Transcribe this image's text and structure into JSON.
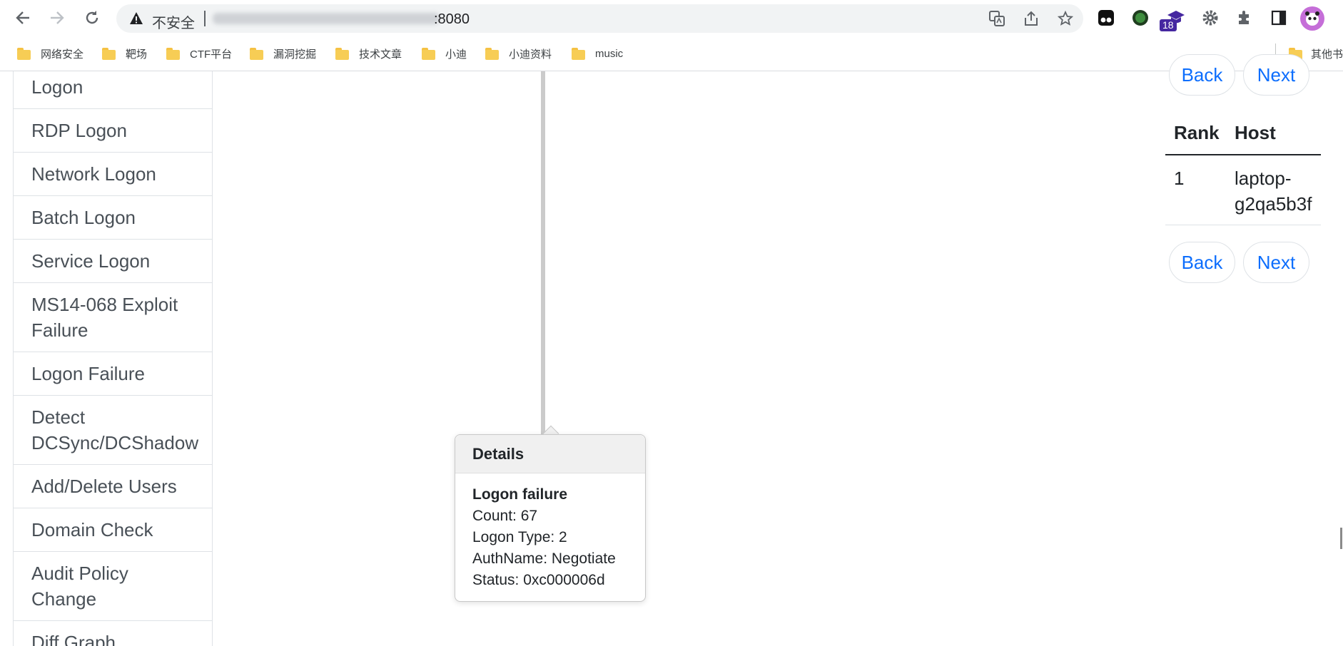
{
  "browser": {
    "security_label": "不安全",
    "url_visible": ":8080",
    "extensions": [
      "tampermonkey-icon",
      "green-ext-icon",
      "graduation-cap-icon",
      "gear-ext-icon",
      "puzzle-icon",
      "side-panel-icon"
    ],
    "extension_badge": "18"
  },
  "bookmarks": [
    "网络安全",
    "靶场",
    "CTF平台",
    "漏洞挖掘",
    "技术文章",
    "小迪",
    "小迪资料",
    "music"
  ],
  "bookmarks_other": "其他书",
  "sidebar": {
    "items": [
      "Logon",
      "RDP Logon",
      "Network Logon",
      "Batch Logon",
      "Service Logon",
      "MS14-068 Exploit Failure",
      "Logon Failure",
      "Detect DCSync/DCShadow",
      "Add/Delete Users",
      "Domain Check",
      "Audit Policy Change",
      "Diff Graph"
    ]
  },
  "popover": {
    "title": "Details",
    "event": "Logon failure",
    "lines": [
      "Count: 67",
      "Logon Type: 2",
      "AuthName: Negotiate",
      "Status: 0xc000006d"
    ]
  },
  "pager": {
    "back": "Back",
    "next": "Next"
  },
  "ranking": {
    "headers": [
      "Rank",
      "Host"
    ],
    "rows": [
      {
        "rank": "1",
        "host": "laptop-g2qa5b3f"
      }
    ]
  },
  "colors": {
    "link": "#0d6efd",
    "text": "#212529",
    "muted": "#495057"
  }
}
